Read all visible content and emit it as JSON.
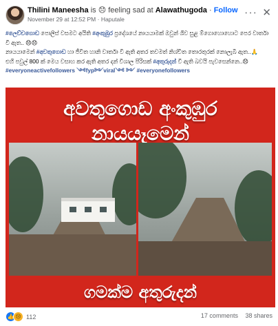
{
  "header": {
    "name": "Thilini Maneesha",
    "activity_prefix": "is 😞 feeling sad at",
    "location": "Alawathugoda",
    "follow_label": "Follow",
    "date": "November 29 at 12:52 PM",
    "place": "Haputale",
    "more_icon": "more-options-icon",
    "close_icon": "close-icon"
  },
  "caption": {
    "line1_tag1": "#ලෙච්චගොඩ",
    "line1_text1": " පොලිස් වසමට අයිති ",
    "line1_tag2": "#අංකුඹුර",
    "line1_text2": " ප්‍රදේශයේ නායයාමක් ඔවුන් ශිව සුළ ම්ගොහොහොට පෙර වාර්තා වී ඇත.. 😞😞",
    "line2_text1": "නායයාමෙන් ",
    "line2_tag": "#අවතුගොඩ",
    "line2_text2": " හා ජීවිත හානි වාර්තා වී ඇති අතර තවමත් නිශ්චිත තොරතුරක් නොලැබී ඇත..🙏",
    "line3_text1": "එහි පවුල් 800 ක් මෙය වසාහ කර ඇති අතර දන් විශාල පිරිසක් ",
    "line3_tag": "#අතුරුදන්",
    "line3_text2": " වී ඇති බවයි පැවසෙන්නෙ..😞",
    "hashtags": "#everyoneactivefollowers ༺fyp༻viral༺ ༻ #everyonefollowers"
  },
  "media": {
    "title_line1": "අවතුගොඩ අංකුඹුර",
    "title_line2": "නායයෑමෙන්",
    "title_line3": "ගමක්ම අතුරුදන්",
    "background_color": "#d2261c"
  },
  "footer": {
    "reaction_like_icon": "like-icon",
    "reaction_sad_icon": "sad-icon",
    "reaction_count": "112",
    "comments": "17 comments",
    "shares": "38 shares"
  }
}
